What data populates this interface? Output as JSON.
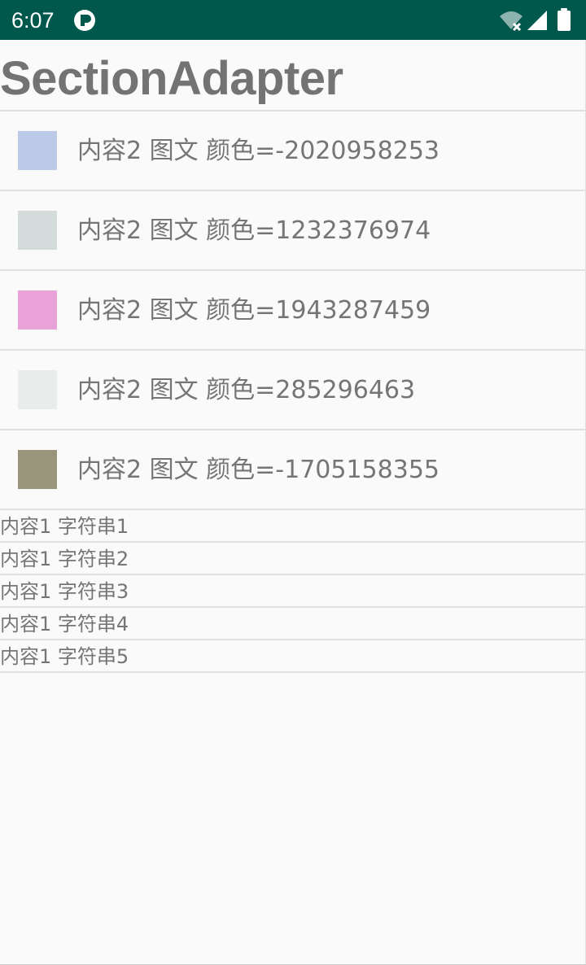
{
  "status_bar": {
    "time": "6:07",
    "background_color": "#00574b",
    "icons": [
      "app-notification-icon",
      "wifi-off-icon",
      "signal-icon",
      "battery-icon"
    ]
  },
  "page": {
    "title": "SectionAdapter"
  },
  "color_items": [
    {
      "label": "内容2 图文 颜色=-2020958253",
      "swatch_color": "#bcc9e7"
    },
    {
      "label": "内容2 图文 颜色=1232376974",
      "swatch_color": "#d3dcda"
    },
    {
      "label": "内容2 图文 颜色=1943287459",
      "swatch_color": "#e9a2d8"
    },
    {
      "label": "内容2 图文 颜色=285296463",
      "swatch_color": "#e8edec"
    },
    {
      "label": "内容2 图文 颜色=-1705158355",
      "swatch_color": "#99957a"
    }
  ],
  "string_items": [
    {
      "label": "内容1 字符串1"
    },
    {
      "label": "内容1 字符串2"
    },
    {
      "label": "内容1 字符串3"
    },
    {
      "label": "内容1 字符串4"
    },
    {
      "label": "内容1 字符串5"
    }
  ]
}
